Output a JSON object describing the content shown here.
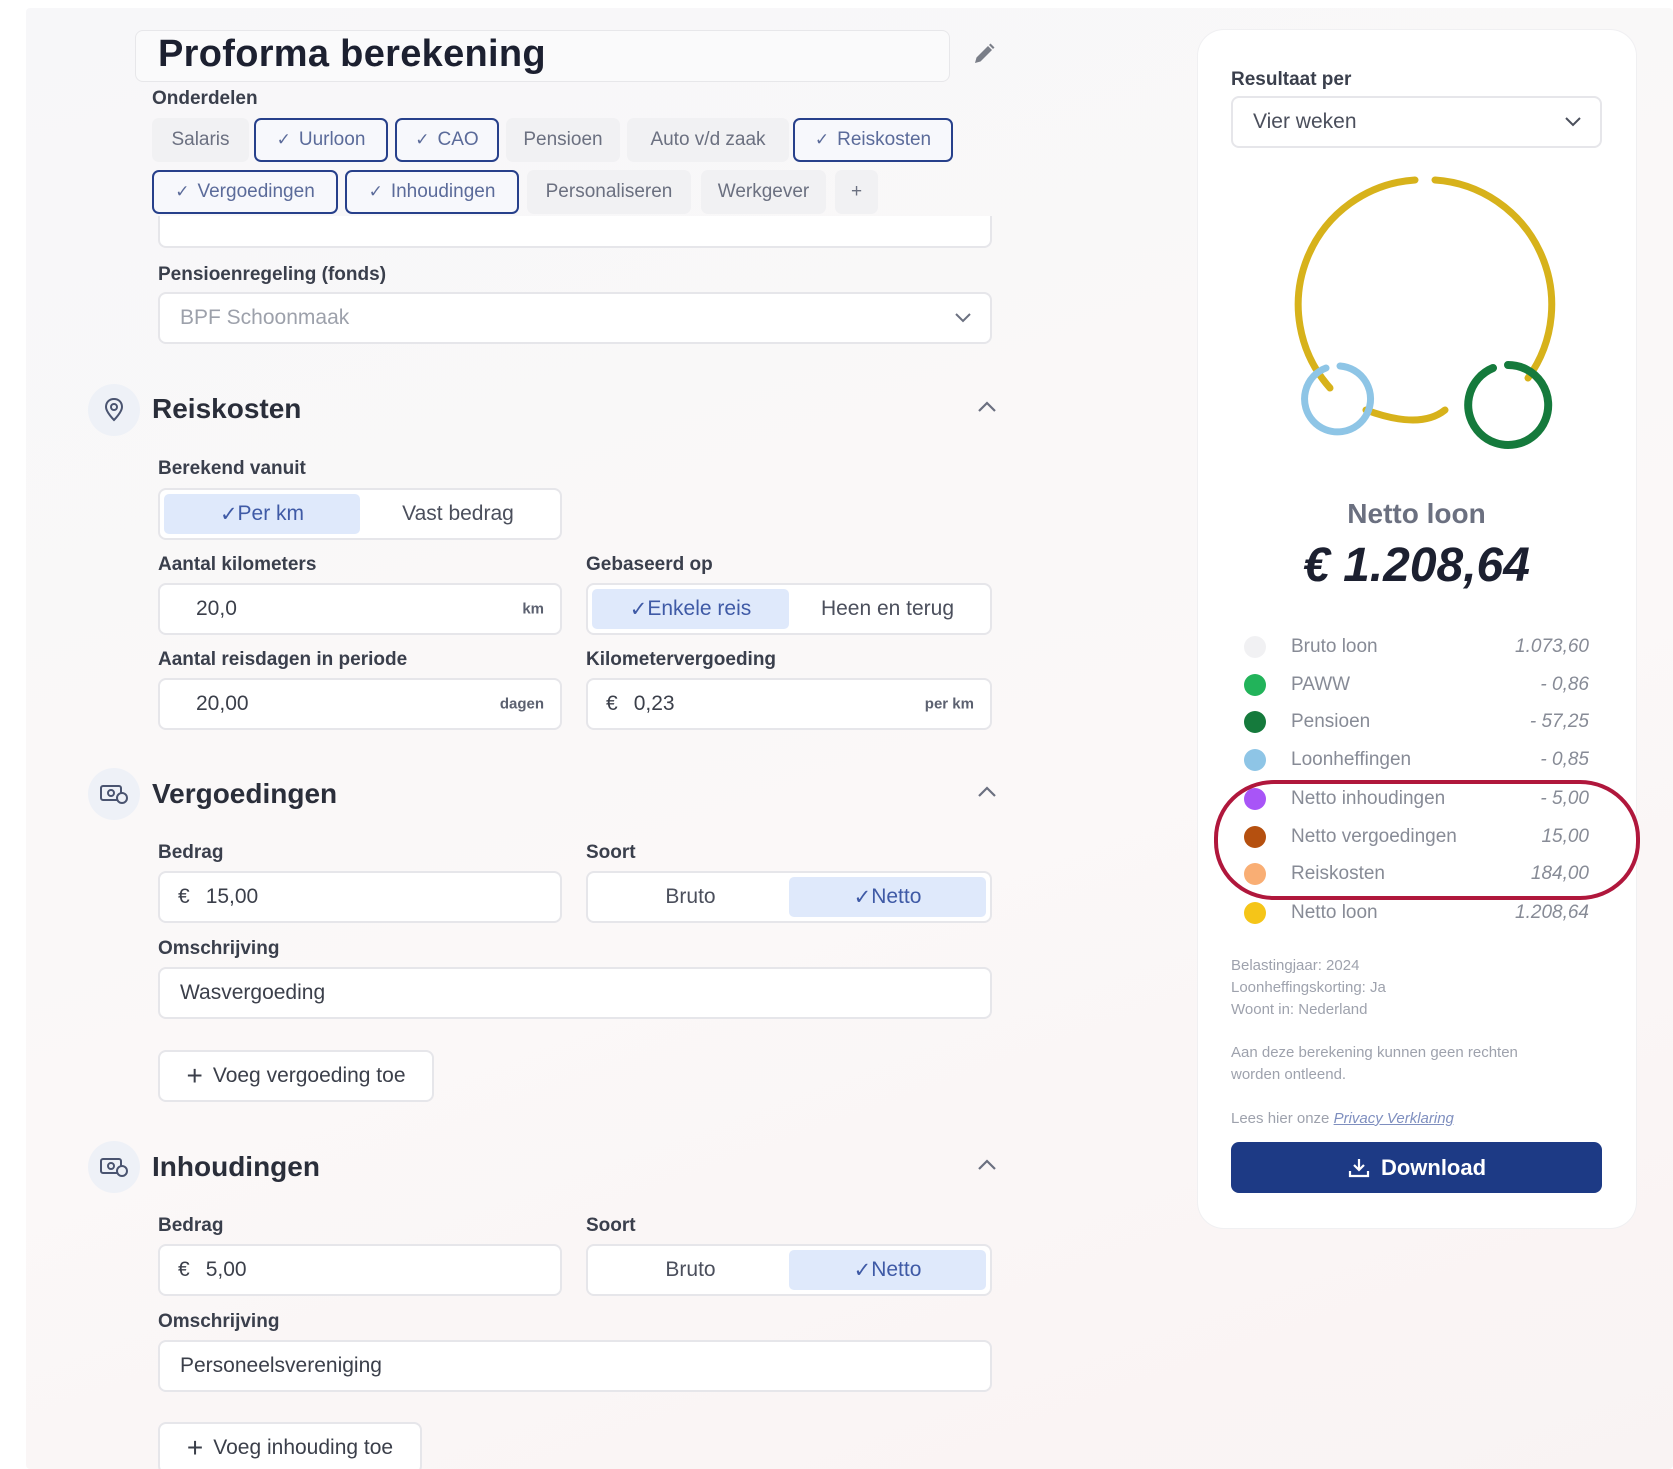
{
  "title": "Proforma berekening",
  "onderdelen": {
    "label": "Onderdelen",
    "chips": [
      {
        "label": "Salaris",
        "selected": false
      },
      {
        "label": "Uurloon",
        "selected": true
      },
      {
        "label": "CAO",
        "selected": true
      },
      {
        "label": "Pensioen",
        "selected": false
      },
      {
        "label": "Auto v/d zaak",
        "selected": false
      },
      {
        "label": "Reiskosten",
        "selected": true
      },
      {
        "label": "Vergoedingen",
        "selected": true
      },
      {
        "label": "Inhoudingen",
        "selected": true
      },
      {
        "label": "Personaliseren",
        "selected": false
      },
      {
        "label": "Werkgever",
        "selected": false
      },
      {
        "label": "+",
        "selected": false
      }
    ]
  },
  "pension": {
    "label": "Pensioenregeling (fonds)",
    "value": "BPF Schoonmaak"
  },
  "reiskosten": {
    "heading": "Reiskosten",
    "berekend_label": "Berekend vanuit",
    "berekend_options": [
      "Per km",
      "Vast bedrag"
    ],
    "berekend_selected": "Per km",
    "km_label": "Aantal kilometers",
    "km_value": "20,0",
    "km_unit": "km",
    "gebaseerd_label": "Gebaseerd op",
    "gebaseerd_options": [
      "Enkele reis",
      "Heen en terug"
    ],
    "gebaseerd_selected": "Enkele reis",
    "dagen_label": "Aantal reisdagen in periode",
    "dagen_value": "20,00",
    "dagen_unit": "dagen",
    "vergoeding_label": "Kilometervergoeding",
    "vergoeding_currency": "€",
    "vergoeding_value": "0,23",
    "vergoeding_unit": "per km"
  },
  "vergoedingen": {
    "heading": "Vergoedingen",
    "bedrag_label": "Bedrag",
    "currency": "€",
    "bedrag_value": "15,00",
    "soort_label": "Soort",
    "soort_options": [
      "Bruto",
      "Netto"
    ],
    "soort_selected": "Netto",
    "omschrijving_label": "Omschrijving",
    "omschrijving_value": "Wasvergoeding",
    "add_label": "Voeg vergoeding toe"
  },
  "inhoudingen": {
    "heading": "Inhoudingen",
    "bedrag_label": "Bedrag",
    "currency": "€",
    "bedrag_value": "5,00",
    "soort_label": "Soort",
    "soort_options": [
      "Bruto",
      "Netto"
    ],
    "soort_selected": "Netto",
    "omschrijving_label": "Omschrijving",
    "omschrijving_value": "Personeelsvereniging",
    "add_label": "Voeg inhouding toe"
  },
  "result": {
    "per_label": "Resultaat per",
    "per_value": "Vier weken",
    "netto_label": "Netto loon",
    "netto_value": "€ 1.208,64",
    "legend": [
      {
        "label": "Bruto loon",
        "value": "1.073,60",
        "color": "#f1f1f3"
      },
      {
        "label": "PAWW",
        "value": "- 0,86",
        "color": "#22b35a"
      },
      {
        "label": "Pensioen",
        "value": "- 57,25",
        "color": "#157a3c"
      },
      {
        "label": "Loonheffingen",
        "value": "- 0,85",
        "color": "#8ec5e6"
      },
      {
        "label": "Netto inhoudingen",
        "value": "- 5,00",
        "color": "#a855f7"
      },
      {
        "label": "Netto vergoedingen",
        "value": "15,00",
        "color": "#b5500f"
      },
      {
        "label": "Reiskosten",
        "value": "184,00",
        "color": "#f9ae74"
      },
      {
        "label": "Netto loon",
        "value": "1.208,64",
        "color": "#f5c518"
      }
    ],
    "notes": [
      "Belastingjaar: 2024",
      "Loonheffingskorting: Ja",
      "Woont in: Nederland"
    ],
    "disclaimer": "Aan deze berekening kunnen geen rechten worden ontleend.",
    "privacy_prefix": "Lees hier onze",
    "privacy_link": "Privacy Verklaring",
    "download_label": "Download"
  },
  "colors": {
    "accent": "#1d3a85",
    "selected_seg": "#dfe9fb",
    "highlight": "#b0173c",
    "donut_main": "#d7b21b",
    "donut_blue": "#8ec5e6",
    "donut_green": "#157a3c"
  }
}
